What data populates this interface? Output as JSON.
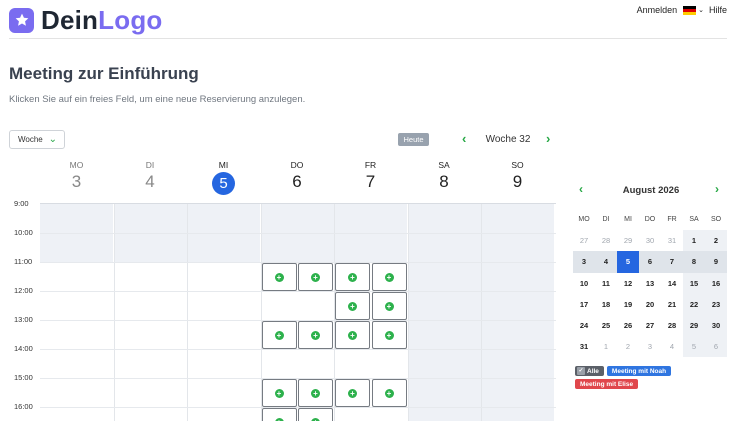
{
  "header": {
    "logo_part1": "Dein",
    "logo_part2": "Logo",
    "login": "Anmelden",
    "help": "Hilfe",
    "language_icon": "flag-de-icon"
  },
  "page": {
    "title": "Meeting zur Einführung",
    "subtitle": "Klicken Sie auf ein freies Feld, um eine neue Reservierung anzulegen."
  },
  "toolbar": {
    "view_selected": "Woche",
    "today": "Heute",
    "week_label": "Woche 32"
  },
  "calendar": {
    "days": [
      {
        "name": "MO",
        "num": "3",
        "state": "past"
      },
      {
        "name": "DI",
        "num": "4",
        "state": "past"
      },
      {
        "name": "MI",
        "num": "5",
        "state": "today"
      },
      {
        "name": "DO",
        "num": "6",
        "state": "future"
      },
      {
        "name": "FR",
        "num": "7",
        "state": "future"
      },
      {
        "name": "SA",
        "num": "8",
        "state": "future"
      },
      {
        "name": "SO",
        "num": "9",
        "state": "future"
      }
    ],
    "times": [
      "9:00",
      "10:00",
      "11:00",
      "12:00",
      "13:00",
      "14:00",
      "15:00",
      "16:00"
    ],
    "free_slots": [
      {
        "day": 3,
        "time": "11:00",
        "half": 0
      },
      {
        "day": 3,
        "time": "11:00",
        "half": 1
      },
      {
        "day": 4,
        "time": "11:00",
        "half": 0
      },
      {
        "day": 4,
        "time": "11:00",
        "half": 1
      },
      {
        "day": 4,
        "time": "12:00",
        "half": 0
      },
      {
        "day": 4,
        "time": "12:00",
        "half": 1
      },
      {
        "day": 3,
        "time": "13:00",
        "half": 0
      },
      {
        "day": 3,
        "time": "13:00",
        "half": 1
      },
      {
        "day": 4,
        "time": "13:00",
        "half": 0
      },
      {
        "day": 4,
        "time": "13:00",
        "half": 1
      },
      {
        "day": 3,
        "time": "15:00",
        "half": 0
      },
      {
        "day": 3,
        "time": "15:00",
        "half": 1
      },
      {
        "day": 4,
        "time": "15:00",
        "half": 0
      },
      {
        "day": 4,
        "time": "15:00",
        "half": 1
      },
      {
        "day": 3,
        "time": "16:00",
        "half": 0
      },
      {
        "day": 3,
        "time": "16:00",
        "half": 1
      }
    ],
    "colors": {
      "today": "#2566e0",
      "free_slot_icon": "#2db14c",
      "unavailable_bg": "#eef1f6"
    }
  },
  "mini_calendar": {
    "title": "August 2026",
    "dow": [
      "MO",
      "DI",
      "MI",
      "DO",
      "FR",
      "SA",
      "SO"
    ],
    "weeks": [
      [
        {
          "d": "27",
          "o": 1
        },
        {
          "d": "28",
          "o": 1
        },
        {
          "d": "29",
          "o": 1
        },
        {
          "d": "30",
          "o": 1
        },
        {
          "d": "31",
          "o": 1
        },
        {
          "d": "1"
        },
        {
          "d": "2"
        }
      ],
      [
        {
          "d": "3",
          "h": 1
        },
        {
          "d": "4",
          "h": 1
        },
        {
          "d": "5",
          "s": 1
        },
        {
          "d": "6",
          "h": 1
        },
        {
          "d": "7",
          "h": 1
        },
        {
          "d": "8",
          "h": 1
        },
        {
          "d": "9",
          "h": 1
        }
      ],
      [
        {
          "d": "10"
        },
        {
          "d": "11"
        },
        {
          "d": "12"
        },
        {
          "d": "13"
        },
        {
          "d": "14"
        },
        {
          "d": "15"
        },
        {
          "d": "16"
        }
      ],
      [
        {
          "d": "17"
        },
        {
          "d": "18"
        },
        {
          "d": "19"
        },
        {
          "d": "20"
        },
        {
          "d": "21"
        },
        {
          "d": "22"
        },
        {
          "d": "23"
        }
      ],
      [
        {
          "d": "24"
        },
        {
          "d": "25"
        },
        {
          "d": "26"
        },
        {
          "d": "27"
        },
        {
          "d": "28"
        },
        {
          "d": "29"
        },
        {
          "d": "30"
        }
      ],
      [
        {
          "d": "31"
        },
        {
          "d": "1",
          "o": 1
        },
        {
          "d": "2",
          "o": 1
        },
        {
          "d": "3",
          "o": 1
        },
        {
          "d": "4",
          "o": 1
        },
        {
          "d": "5",
          "o": 1
        },
        {
          "d": "6",
          "o": 1
        }
      ]
    ]
  },
  "legend": {
    "all": "Alle",
    "noah": "Meeting mit Noah",
    "elise": "Meeting mit Elise"
  }
}
